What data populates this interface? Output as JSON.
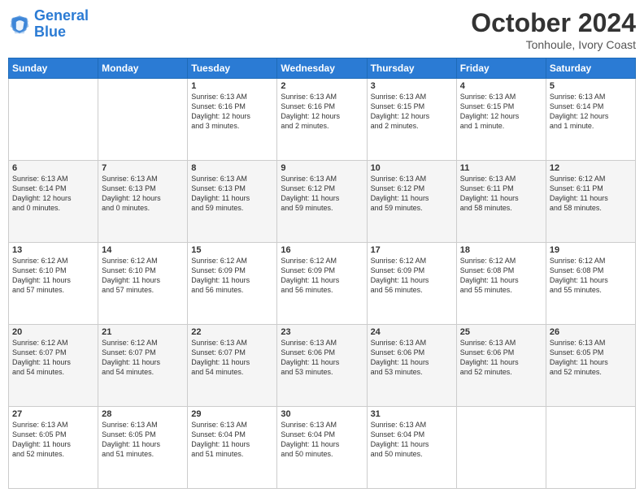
{
  "logo": {
    "line1": "General",
    "line2": "Blue"
  },
  "header": {
    "title": "October 2024",
    "subtitle": "Tonhoule, Ivory Coast"
  },
  "days_of_week": [
    "Sunday",
    "Monday",
    "Tuesday",
    "Wednesday",
    "Thursday",
    "Friday",
    "Saturday"
  ],
  "weeks": [
    [
      {
        "day": "",
        "info": ""
      },
      {
        "day": "",
        "info": ""
      },
      {
        "day": "1",
        "info": "Sunrise: 6:13 AM\nSunset: 6:16 PM\nDaylight: 12 hours\nand 3 minutes."
      },
      {
        "day": "2",
        "info": "Sunrise: 6:13 AM\nSunset: 6:16 PM\nDaylight: 12 hours\nand 2 minutes."
      },
      {
        "day": "3",
        "info": "Sunrise: 6:13 AM\nSunset: 6:15 PM\nDaylight: 12 hours\nand 2 minutes."
      },
      {
        "day": "4",
        "info": "Sunrise: 6:13 AM\nSunset: 6:15 PM\nDaylight: 12 hours\nand 1 minute."
      },
      {
        "day": "5",
        "info": "Sunrise: 6:13 AM\nSunset: 6:14 PM\nDaylight: 12 hours\nand 1 minute."
      }
    ],
    [
      {
        "day": "6",
        "info": "Sunrise: 6:13 AM\nSunset: 6:14 PM\nDaylight: 12 hours\nand 0 minutes."
      },
      {
        "day": "7",
        "info": "Sunrise: 6:13 AM\nSunset: 6:13 PM\nDaylight: 12 hours\nand 0 minutes."
      },
      {
        "day": "8",
        "info": "Sunrise: 6:13 AM\nSunset: 6:13 PM\nDaylight: 11 hours\nand 59 minutes."
      },
      {
        "day": "9",
        "info": "Sunrise: 6:13 AM\nSunset: 6:12 PM\nDaylight: 11 hours\nand 59 minutes."
      },
      {
        "day": "10",
        "info": "Sunrise: 6:13 AM\nSunset: 6:12 PM\nDaylight: 11 hours\nand 59 minutes."
      },
      {
        "day": "11",
        "info": "Sunrise: 6:13 AM\nSunset: 6:11 PM\nDaylight: 11 hours\nand 58 minutes."
      },
      {
        "day": "12",
        "info": "Sunrise: 6:12 AM\nSunset: 6:11 PM\nDaylight: 11 hours\nand 58 minutes."
      }
    ],
    [
      {
        "day": "13",
        "info": "Sunrise: 6:12 AM\nSunset: 6:10 PM\nDaylight: 11 hours\nand 57 minutes."
      },
      {
        "day": "14",
        "info": "Sunrise: 6:12 AM\nSunset: 6:10 PM\nDaylight: 11 hours\nand 57 minutes."
      },
      {
        "day": "15",
        "info": "Sunrise: 6:12 AM\nSunset: 6:09 PM\nDaylight: 11 hours\nand 56 minutes."
      },
      {
        "day": "16",
        "info": "Sunrise: 6:12 AM\nSunset: 6:09 PM\nDaylight: 11 hours\nand 56 minutes."
      },
      {
        "day": "17",
        "info": "Sunrise: 6:12 AM\nSunset: 6:09 PM\nDaylight: 11 hours\nand 56 minutes."
      },
      {
        "day": "18",
        "info": "Sunrise: 6:12 AM\nSunset: 6:08 PM\nDaylight: 11 hours\nand 55 minutes."
      },
      {
        "day": "19",
        "info": "Sunrise: 6:12 AM\nSunset: 6:08 PM\nDaylight: 11 hours\nand 55 minutes."
      }
    ],
    [
      {
        "day": "20",
        "info": "Sunrise: 6:12 AM\nSunset: 6:07 PM\nDaylight: 11 hours\nand 54 minutes."
      },
      {
        "day": "21",
        "info": "Sunrise: 6:12 AM\nSunset: 6:07 PM\nDaylight: 11 hours\nand 54 minutes."
      },
      {
        "day": "22",
        "info": "Sunrise: 6:13 AM\nSunset: 6:07 PM\nDaylight: 11 hours\nand 54 minutes."
      },
      {
        "day": "23",
        "info": "Sunrise: 6:13 AM\nSunset: 6:06 PM\nDaylight: 11 hours\nand 53 minutes."
      },
      {
        "day": "24",
        "info": "Sunrise: 6:13 AM\nSunset: 6:06 PM\nDaylight: 11 hours\nand 53 minutes."
      },
      {
        "day": "25",
        "info": "Sunrise: 6:13 AM\nSunset: 6:06 PM\nDaylight: 11 hours\nand 52 minutes."
      },
      {
        "day": "26",
        "info": "Sunrise: 6:13 AM\nSunset: 6:05 PM\nDaylight: 11 hours\nand 52 minutes."
      }
    ],
    [
      {
        "day": "27",
        "info": "Sunrise: 6:13 AM\nSunset: 6:05 PM\nDaylight: 11 hours\nand 52 minutes."
      },
      {
        "day": "28",
        "info": "Sunrise: 6:13 AM\nSunset: 6:05 PM\nDaylight: 11 hours\nand 51 minutes."
      },
      {
        "day": "29",
        "info": "Sunrise: 6:13 AM\nSunset: 6:04 PM\nDaylight: 11 hours\nand 51 minutes."
      },
      {
        "day": "30",
        "info": "Sunrise: 6:13 AM\nSunset: 6:04 PM\nDaylight: 11 hours\nand 50 minutes."
      },
      {
        "day": "31",
        "info": "Sunrise: 6:13 AM\nSunset: 6:04 PM\nDaylight: 11 hours\nand 50 minutes."
      },
      {
        "day": "",
        "info": ""
      },
      {
        "day": "",
        "info": ""
      }
    ]
  ]
}
